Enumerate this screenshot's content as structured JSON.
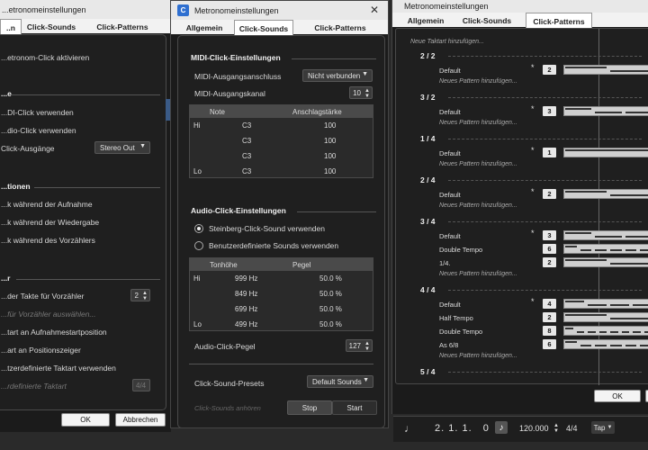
{
  "window_left": {
    "title": "...etronomeinstellungen",
    "tabs": [
      "..n",
      "Click-Sounds",
      "Click-Patterns"
    ],
    "rows": [
      "...etronom-Click aktivieren",
      "...e",
      "...DI-Click verwenden",
      "...dio-Click verwenden",
      "Click-Ausgänge",
      "...tionen",
      "...k während der Aufnahme",
      "...k während der Wiedergabe",
      "...k während des Vorzählers",
      "...r",
      "...der Takte für Vorzähler",
      "...für Vorzähler auswählen...",
      "...tart an Aufnahmestartposition",
      "...art an Positionszeiger",
      "...tzerdefinierte Taktart verwenden",
      "...rdefinierte Taktart"
    ],
    "click_outputs_value": "Stereo Out",
    "precount_bars": "2",
    "time_signature": "4/4",
    "ok_label": "OK",
    "cancel_label": "Abbrechen"
  },
  "window_center": {
    "title": "Metronomeinstellungen",
    "tabs": [
      "Allgemein",
      "Click-Sounds",
      "Click-Patterns"
    ],
    "midi_section": "MIDI-Click-Einstellungen",
    "midi_output_label": "MIDI-Ausgangsanschluss",
    "midi_output_value": "Nicht verbunden",
    "midi_channel_label": "MIDI-Ausgangskanal",
    "midi_channel_value": "10",
    "midi_table": {
      "headers": [
        "Note",
        "Anschlagstärke"
      ],
      "rows": [
        {
          "row_label": "Hi",
          "note": "C3",
          "velocity": "100"
        },
        {
          "row_label": "",
          "note": "C3",
          "velocity": "100"
        },
        {
          "row_label": "",
          "note": "C3",
          "velocity": "100"
        },
        {
          "row_label": "Lo",
          "note": "C3",
          "velocity": "100"
        }
      ]
    },
    "audio_section": "Audio-Click-Einstellungen",
    "radio_steinberg": "Steinberg-Click-Sound verwenden",
    "radio_custom": "Benutzerdefinierte Sounds verwenden",
    "audio_table": {
      "headers": [
        "Tonhöhe",
        "Pegel"
      ],
      "rows": [
        {
          "row_label": "Hi",
          "pitch": "999 Hz",
          "level": "50.0 %"
        },
        {
          "row_label": "",
          "pitch": "849 Hz",
          "level": "50.0 %"
        },
        {
          "row_label": "",
          "pitch": "699 Hz",
          "level": "50.0 %"
        },
        {
          "row_label": "Lo",
          "pitch": "499 Hz",
          "level": "50.0 %"
        }
      ]
    },
    "audio_level_label": "Audio-Click-Pegel",
    "audio_level_value": "127",
    "presets_label": "Click-Sound-Presets",
    "presets_value": "Default Sounds",
    "listen_label": "Click-Sounds anhören",
    "stop_label": "Stop",
    "start_label": "Start"
  },
  "window_right": {
    "title": "Metronomeinstellungen",
    "tabs": [
      "Allgemein",
      "Click-Sounds",
      "Click-Patterns"
    ],
    "new_signature": "Neue Taktart hinzufügen...",
    "new_pattern": "Neues Pattern hinzufügen...",
    "groups": [
      {
        "sig": "2 / 2",
        "patterns": [
          {
            "name": "Default",
            "beats": "2",
            "star": true
          }
        ]
      },
      {
        "sig": "3 / 2",
        "patterns": [
          {
            "name": "Default",
            "beats": "3",
            "star": true
          }
        ]
      },
      {
        "sig": "1 / 4",
        "patterns": [
          {
            "name": "Default",
            "beats": "1",
            "star": true
          }
        ]
      },
      {
        "sig": "2 / 4",
        "patterns": [
          {
            "name": "Default",
            "beats": "2",
            "star": true
          }
        ]
      },
      {
        "sig": "3 / 4",
        "patterns": [
          {
            "name": "Default",
            "beats": "3",
            "star": true
          },
          {
            "name": "Double Tempo",
            "beats": "6",
            "star": false
          },
          {
            "name": "1/4.",
            "beats": "2",
            "star": false
          }
        ]
      },
      {
        "sig": "4 / 4",
        "patterns": [
          {
            "name": "Default",
            "beats": "4",
            "star": true
          },
          {
            "name": "Half Tempo",
            "beats": "2",
            "star": false
          },
          {
            "name": "Double Tempo",
            "beats": "8",
            "star": false
          },
          {
            "name": "As 6/8",
            "beats": "6",
            "star": false
          }
        ]
      },
      {
        "sig": "5 / 4",
        "patterns": []
      }
    ],
    "ok_label": "OK"
  },
  "transport": {
    "position": "2. 1. 1.   0",
    "tempo": "120.000",
    "signature": "4/4",
    "tap_label": "Tap"
  }
}
